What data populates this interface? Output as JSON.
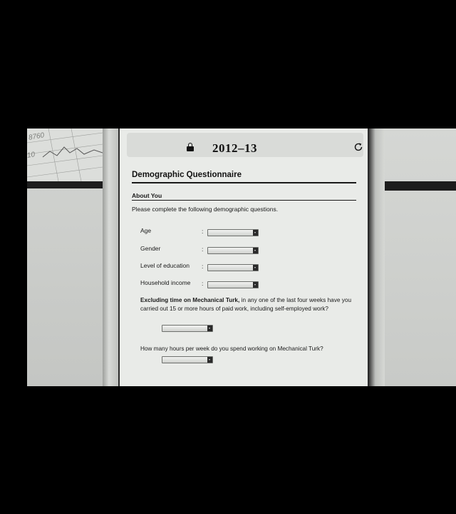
{
  "browser": {
    "address": "2012–13"
  },
  "backdrop": {
    "chart_numbers": [
      "8760",
      "10"
    ]
  },
  "form": {
    "title": "Demographic Questionnaire",
    "section_title": "About You",
    "intro": "Please complete the following demographic questions.",
    "fields": [
      {
        "label": "Age",
        "colon": ":"
      },
      {
        "label": "Gender",
        "colon": ":"
      },
      {
        "label": "Level of education",
        "colon": ":"
      },
      {
        "label": "Household income",
        "colon": ":"
      }
    ],
    "q1": {
      "bold": "Excluding time on Mechanical Turk,",
      "rest": " in any one of the last four weeks have you carried out 15 or more hours of paid work, including self-employed work?"
    },
    "q2": {
      "text": "How many hours per week do you spend working on Mechanical Turk?"
    }
  }
}
